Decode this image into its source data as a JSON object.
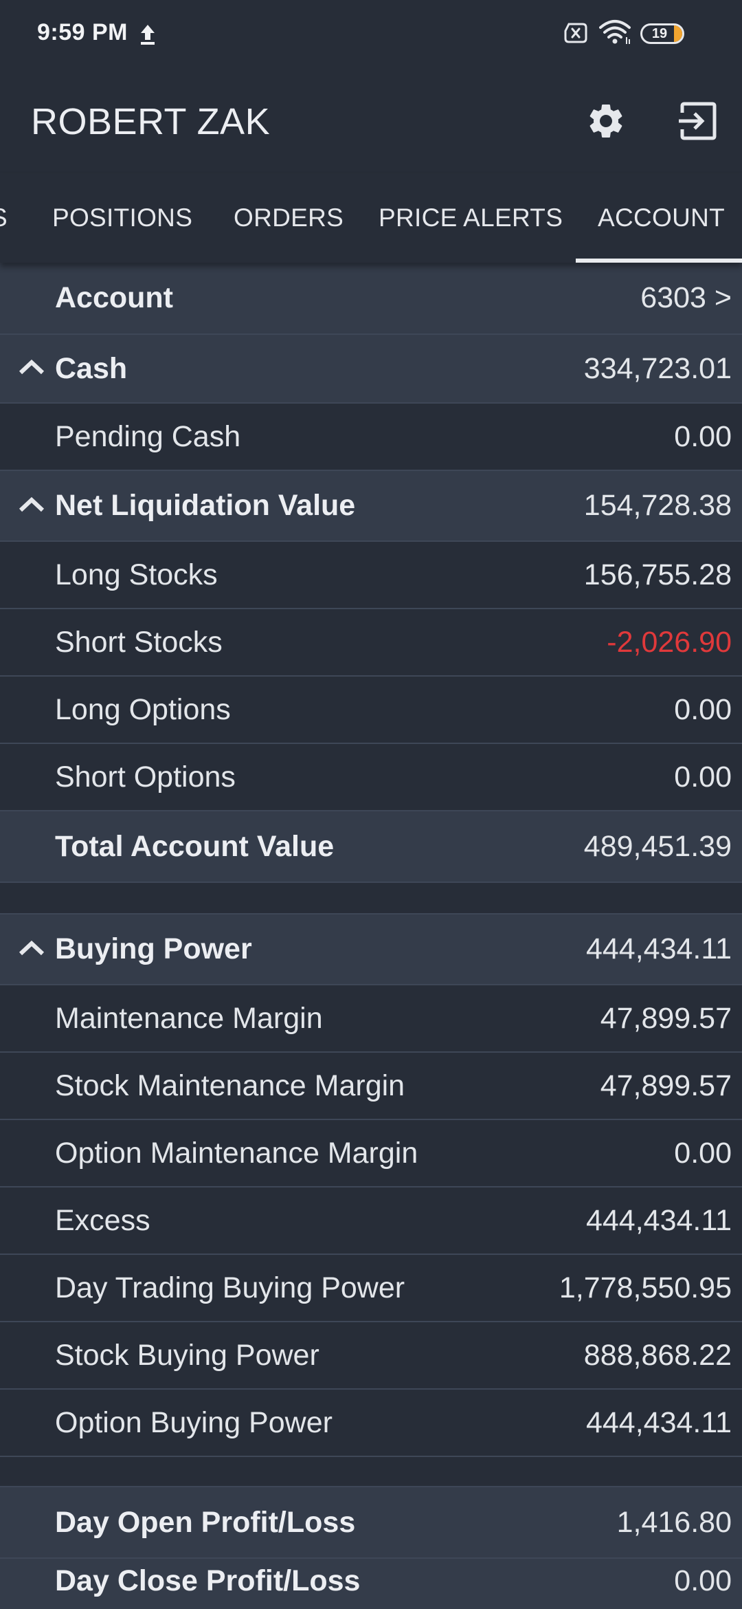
{
  "status_bar": {
    "time": "9:59 PM",
    "battery_level": "19",
    "icons": [
      "upload-icon",
      "sim-off-icon",
      "wifi-icon",
      "battery-icon"
    ]
  },
  "header": {
    "title": "ROBERT ZAK",
    "icons": [
      "gear-icon",
      "logout-icon"
    ]
  },
  "tabs": [
    {
      "label": "S"
    },
    {
      "label": "POSITIONS"
    },
    {
      "label": "ORDERS"
    },
    {
      "label": "PRICE ALERTS"
    },
    {
      "label": "ACCOUNT"
    }
  ],
  "active_tab": "ACCOUNT",
  "colors": {
    "background": "#272d38",
    "header_row": "#343c4a",
    "negative": "#e0393b",
    "accent": "#e9ebee",
    "battery_low": "#f2a530"
  },
  "rows": {
    "account": {
      "label": "Account",
      "value": "6303 >"
    },
    "cash": {
      "label": "Cash",
      "value": "334,723.01"
    },
    "pending_cash": {
      "label": "Pending Cash",
      "value": "0.00"
    },
    "net_liquidation": {
      "label": "Net Liquidation Value",
      "value": "154,728.38"
    },
    "long_stocks": {
      "label": "Long Stocks",
      "value": "156,755.28"
    },
    "short_stocks": {
      "label": "Short Stocks",
      "value": "-2,026.90"
    },
    "long_options": {
      "label": "Long Options",
      "value": "0.00"
    },
    "short_options": {
      "label": "Short Options",
      "value": "0.00"
    },
    "total_account_value": {
      "label": "Total Account Value",
      "value": "489,451.39"
    },
    "buying_power": {
      "label": "Buying Power",
      "value": "444,434.11"
    },
    "maintenance_margin": {
      "label": "Maintenance Margin",
      "value": "47,899.57"
    },
    "stock_maintenance_margin": {
      "label": "Stock Maintenance Margin",
      "value": "47,899.57"
    },
    "option_maintenance_margin": {
      "label": "Option Maintenance Margin",
      "value": "0.00"
    },
    "excess": {
      "label": "Excess",
      "value": "444,434.11"
    },
    "day_trading_buying_power": {
      "label": "Day Trading Buying Power",
      "value": "1,778,550.95"
    },
    "stock_buying_power": {
      "label": "Stock Buying Power",
      "value": "888,868.22"
    },
    "option_buying_power": {
      "label": "Option Buying Power",
      "value": "444,434.11"
    },
    "day_open_pl": {
      "label": "Day Open Profit/Loss",
      "value": "1,416.80"
    },
    "day_close_pl": {
      "label": "Day Close Profit/Loss",
      "value": "0.00"
    }
  }
}
